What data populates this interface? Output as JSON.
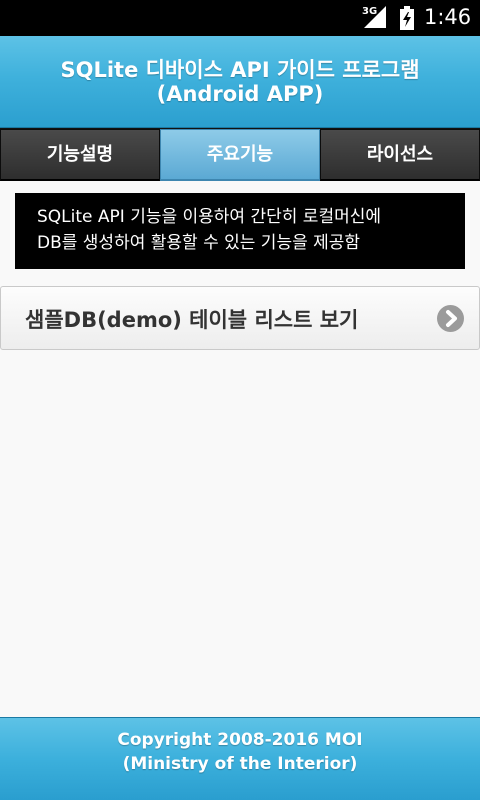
{
  "status_bar": {
    "network": "3G",
    "time": "1:46",
    "signal_icon": "cell-signal-icon",
    "battery_icon": "battery-charging-icon"
  },
  "header": {
    "title_line1": "SQLite 디바이스 API 가이드 프로그램",
    "title_line2": "(Android APP)"
  },
  "tabs": [
    {
      "label": "기능설명",
      "active": false
    },
    {
      "label": "주요기능",
      "active": true
    },
    {
      "label": "라이선스",
      "active": false
    }
  ],
  "description": {
    "line1": "SQLite API 기능을 이용하여 간단히 로컬머신에",
    "line2": "DB를 생성하여 활용할 수 있는 기능을 제공함"
  },
  "list_items": [
    {
      "label": "샘플DB(demo) 테이블 리스트 보기",
      "icon": "chevron-right-circle-icon"
    }
  ],
  "footer": {
    "line1": "Copyright 2008-2016 MOI",
    "line2": "(Ministry of the Interior)"
  },
  "colors": {
    "header_blue": "#3fb1dc",
    "tab_active": "#5ba9d4",
    "tab_inactive": "#2e2e2e",
    "description_bg": "#000000"
  }
}
